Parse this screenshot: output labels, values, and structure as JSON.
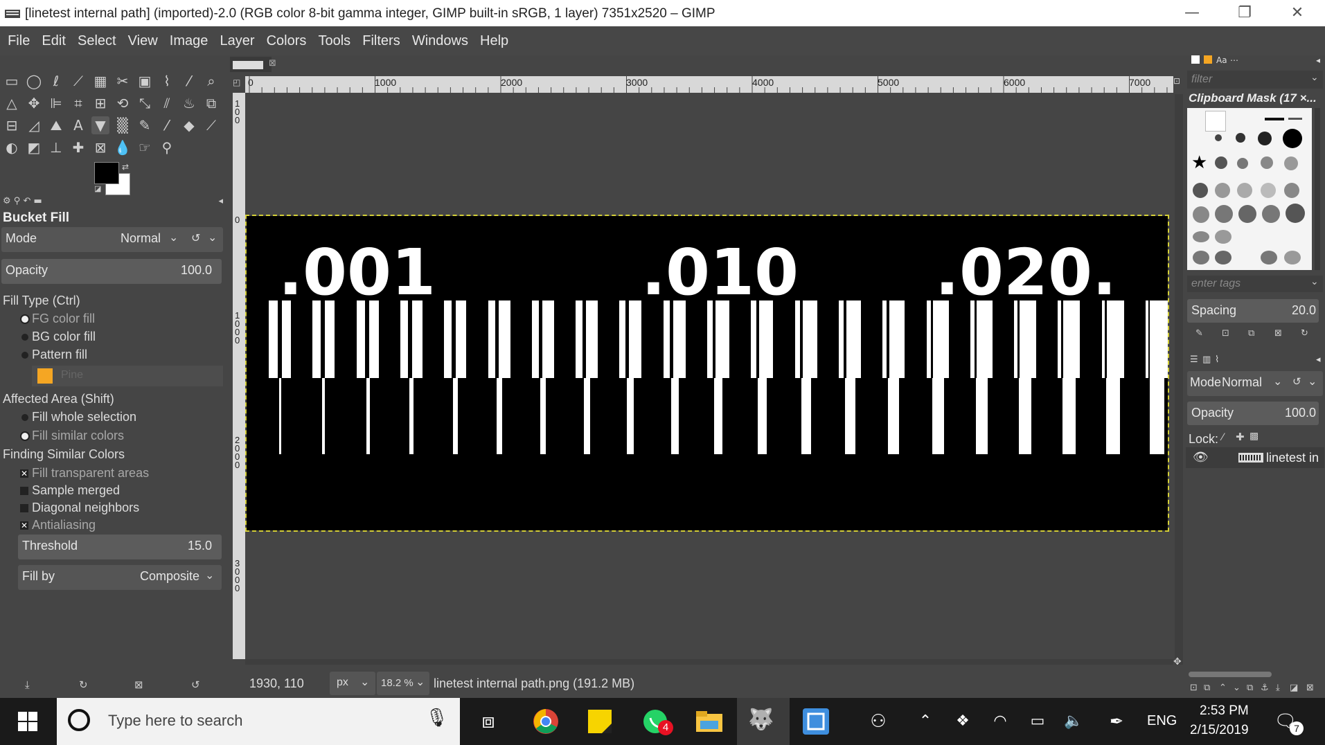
{
  "window": {
    "title": "[linetest internal path] (imported)-2.0 (RGB color 8-bit gamma integer, GIMP built-in sRGB, 1 layer) 7351x2520 – GIMP",
    "minimize": "—",
    "restore": "❐",
    "close": "✕"
  },
  "menu": [
    "File",
    "Edit",
    "Select",
    "View",
    "Image",
    "Layer",
    "Colors",
    "Tools",
    "Filters",
    "Windows",
    "Help"
  ],
  "tool_options": {
    "title": "Bucket Fill",
    "mode_label": "Mode",
    "mode_value": "Normal",
    "opacity_label": "Opacity",
    "opacity_value": "100.0",
    "fill_type_label": "Fill Type  (Ctrl)",
    "fill_types": [
      "FG color fill",
      "BG color fill",
      "Pattern fill"
    ],
    "pattern_name": "Pine",
    "affected_area_label": "Affected Area  (Shift)",
    "affected_options": [
      "Fill whole selection",
      "Fill similar colors"
    ],
    "finding_label": "Finding Similar Colors",
    "finding_options": [
      "Fill transparent areas",
      "Sample merged",
      "Diagonal neighbors",
      "Antialiasing"
    ],
    "threshold_label": "Threshold",
    "threshold_value": "15.0",
    "fill_by_label": "Fill by",
    "fill_by_value": "Composite"
  },
  "rulers": {
    "h_ticks": [
      "0",
      "1000",
      "2000",
      "3000",
      "4000",
      "5000",
      "6000",
      "7000"
    ],
    "v_ticks": [
      "100",
      "0",
      "1000",
      "2000",
      "3000"
    ]
  },
  "image_content": {
    "labels": [
      ".001",
      ".010",
      ".020."
    ]
  },
  "status": {
    "coords": "1930, 110",
    "unit": "px",
    "zoom": "18.2 %",
    "file_info": "linetest internal path.png (191.2 MB)"
  },
  "brushes": {
    "filter_placeholder": "filter",
    "title": "Clipboard Mask (17 ×...",
    "tags_placeholder": "enter tags",
    "spacing_label": "Spacing",
    "spacing_value": "20.0"
  },
  "layers": {
    "mode_label": "Mode",
    "mode_value": "Normal",
    "opacity_label": "Opacity",
    "opacity_value": "100.0",
    "lock_label": "Lock:",
    "layer_name": "linetest in"
  },
  "taskbar": {
    "search_placeholder": "Type here to search",
    "whatsapp_badge": "4",
    "language": "ENG",
    "time": "2:53 PM",
    "date": "2/15/2019",
    "notification_count": "7"
  }
}
